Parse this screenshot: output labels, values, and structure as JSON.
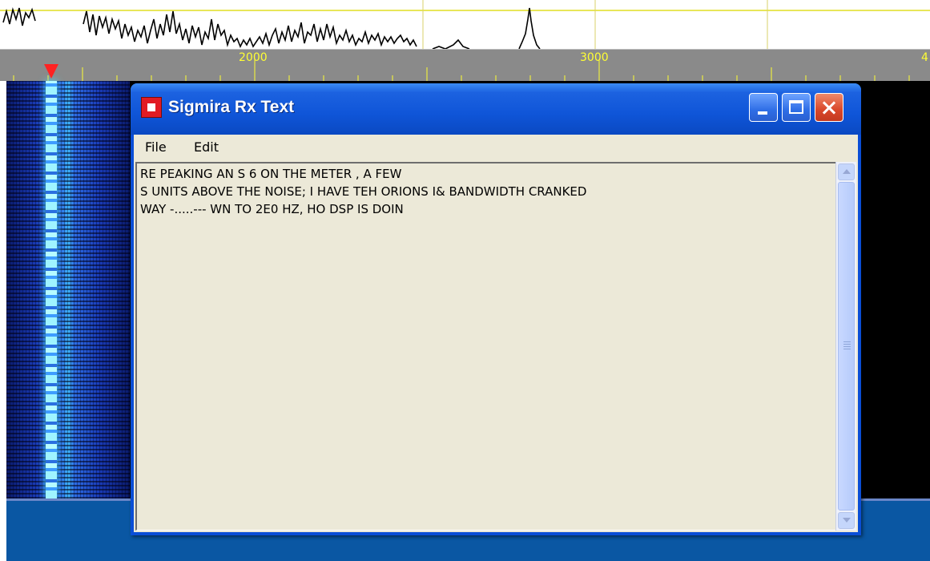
{
  "spectrum": {
    "ruler": {
      "tick_labels": [
        "2000",
        "3000",
        "4"
      ],
      "text_color": "#ffff33"
    }
  },
  "waterfall": {
    "marker_icon": "red-triangle-marker",
    "colors": {
      "signal": "#3fb8ff",
      "background": "#000000",
      "bottom_bar": "#0a57a3"
    }
  },
  "window": {
    "title": "Sigmira Rx Text",
    "icon": "app-icon",
    "controls": {
      "minimize": "minimize-icon",
      "maximize": "maximize-icon",
      "close": "close-icon"
    },
    "menu": {
      "file": "File",
      "edit": "Edit"
    },
    "text_lines": [
      "RE PEAKING AN S 6 ON THE METER , A FEW",
      "S UNITS ABOVE THE NOISE; I HAVE TEH ORIONS I& BANDWIDTH CRANKED",
      "WAY -.....--- WN TO 2E0 HZ, HO DSP IS DOIN"
    ],
    "colors": {
      "titlebar": "#0f55d8",
      "close_button": "#d9472a",
      "client": "#ece9d8"
    }
  }
}
